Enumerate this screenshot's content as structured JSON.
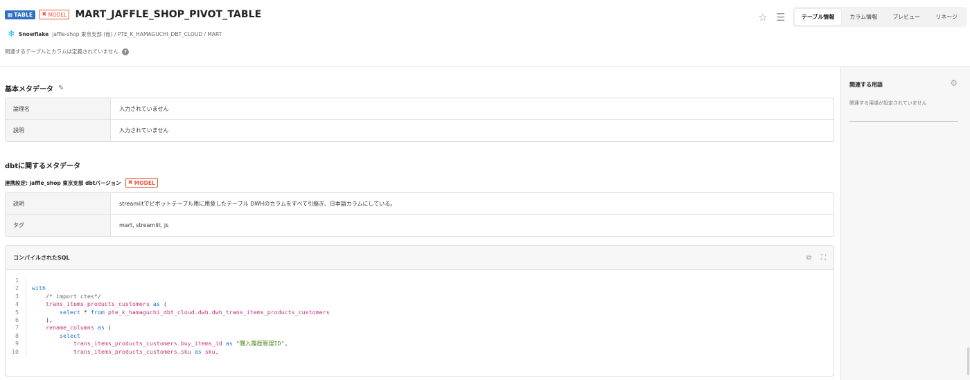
{
  "header": {
    "badge_table": "TABLE",
    "badge_model": "MODEL",
    "title": "MART_JAFFLE_SHOP_PIVOT_TABLE",
    "breadcrumb": {
      "platform": "Snowflake",
      "path": "jaffle-shop 東京支部 (仮) / PTE_K_HAMAGUCHI_DBT_CLOUD / MART"
    },
    "related_note": "関連するテーブルとカラムは定義されていません",
    "tabs": [
      "テーブル情報",
      "カラム情報",
      "プレビュー",
      "リネージ"
    ],
    "active_tab": "テーブル情報"
  },
  "basic_meta": {
    "title": "基本メタデータ",
    "rows": [
      {
        "key": "論理名",
        "value": "入力されていません"
      },
      {
        "key": "説明",
        "value": "入力されていません"
      }
    ]
  },
  "dbt_meta": {
    "title": "dbtに関するメタデータ",
    "settings": "連携設定: jaffle_shop 東京支部 dbtバージョン",
    "badge": "MODEL",
    "rows": [
      {
        "key": "説明",
        "value": "streamlitでピボットテーブル用に用意したテーブル DWHのカラムをすべて引継ぎ、日本語カラムにしている。"
      },
      {
        "key": "タグ",
        "value": "mart, streamlit, js"
      }
    ]
  },
  "sql": {
    "title": "コンパイルされたSQL",
    "line_numbers": [
      "1",
      "2",
      "3",
      "4",
      "5",
      "6",
      "7",
      "8",
      "9",
      "10"
    ]
  },
  "side_panel": {
    "title": "関連する用語",
    "empty": "関連する用語が設定されていません"
  },
  "colors": {
    "table_badge": "#2f6fc4",
    "model_badge": "#e8583a",
    "snowflake": "#29b5e8"
  }
}
